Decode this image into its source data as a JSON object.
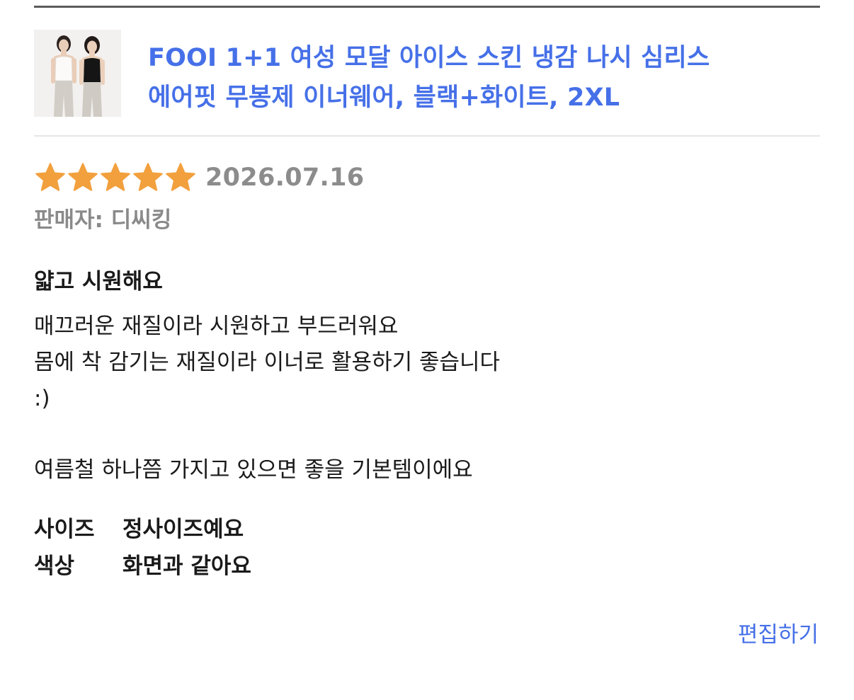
{
  "product": {
    "title_line1": "FOOI 1+1 여성 모달 아이스 스킨 냉감 나시 심리스",
    "title_line2": "에어핏 무봉제 이너웨어, 블랙+화이트, 2XL"
  },
  "review": {
    "rating": 5,
    "max_rating": 5,
    "date": "2026.07.16",
    "seller": "판매자: 디씨킹",
    "title": "얇고 시원해요",
    "body": [
      "매끄러운 재질이라 시원하고 부드러워요",
      "몸에 착 감기는 재질이라 이너로 활용하기 좋습니다",
      ":)",
      "",
      "여름철 하나쯤 가지고 있으면 좋을 기본템이에요"
    ],
    "attributes": [
      {
        "key": "사이즈",
        "value": "정사이즈예요"
      },
      {
        "key": "색상",
        "value": "화면과 같아요"
      }
    ]
  },
  "actions": {
    "edit_label": "편집하기"
  },
  "colors": {
    "accent": "#4670e8",
    "star": "#f2a03d",
    "muted": "#8a8a8a"
  },
  "icons": {
    "star": "star-icon"
  }
}
